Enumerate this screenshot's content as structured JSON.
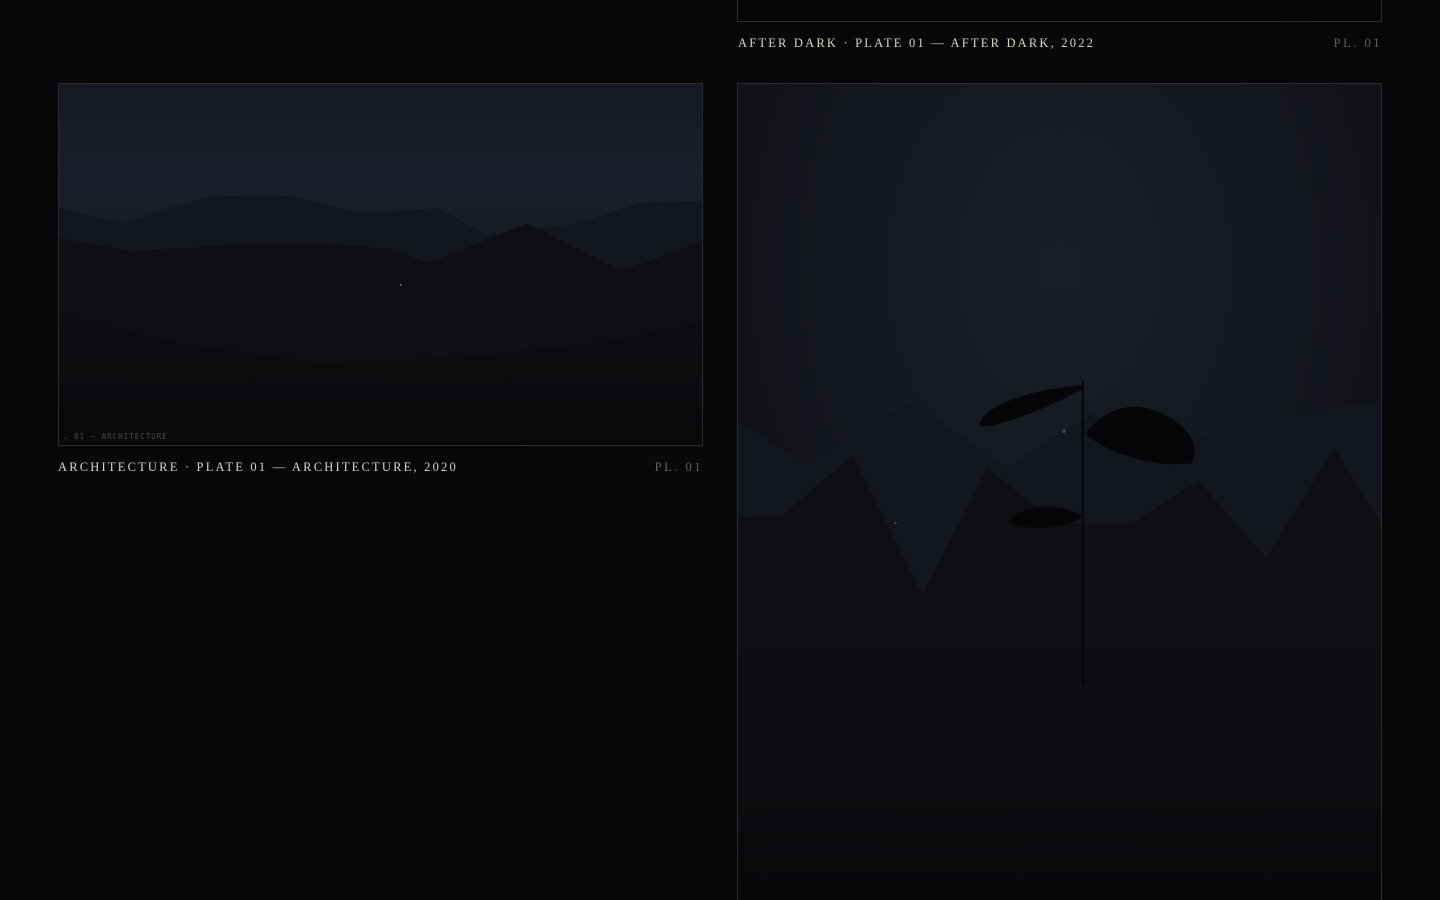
{
  "plates": [
    {
      "id": "after-dark",
      "caption_title": "After Dark · Plate 01 — After Dark, 2022",
      "caption_plate": "PL. 01"
    },
    {
      "id": "architecture",
      "caption_title": "Architecture · Plate 01 — Architecture, 2020",
      "caption_plate": "PL. 01",
      "inframe_label": ". 01 — ARCHITECTURE"
    },
    {
      "id": "after-dark-large"
    }
  ],
  "colors": {
    "background": "#08090b",
    "caption_text": "#d9d3c4",
    "caption_muted": "#5d5f64",
    "frame_border": "#2a2c31"
  }
}
